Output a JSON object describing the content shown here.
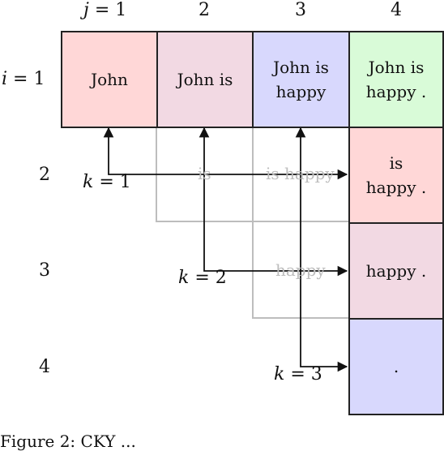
{
  "column_labels": {
    "col1_var": "j",
    "col1_eq": " = 1",
    "col2": "2",
    "col3": "3",
    "col4": "4"
  },
  "row_labels": {
    "row1_var": "i",
    "row1_eq": " = 1",
    "row2": "2",
    "row3": "3",
    "row4": "4"
  },
  "cells": {
    "r1c1": "John",
    "r1c2": "John is",
    "r1c3": "John is\nhappy",
    "r1c4": "John is\nhappy .",
    "r2c4": "is\nhappy .",
    "r3c4": "happy .",
    "r4c4": "."
  },
  "faint_labels": {
    "is": "is",
    "is_happy": "is happy",
    "happy": "happy"
  },
  "split_labels": {
    "k1_var": "k",
    "k1_eq": " = 1",
    "k2_var": "k",
    "k2_eq": " = 2",
    "k3_var": "k",
    "k3_eq": " = 3"
  },
  "caption": "Figure 2: CKY ...",
  "colors": {
    "pink": "#ffd7d7",
    "mauve": "#f2d9e3",
    "lavender": "#d8d8fd",
    "mint": "#d9fbd8",
    "faint_line": "#bdbdbd",
    "arrow": "#111111"
  }
}
